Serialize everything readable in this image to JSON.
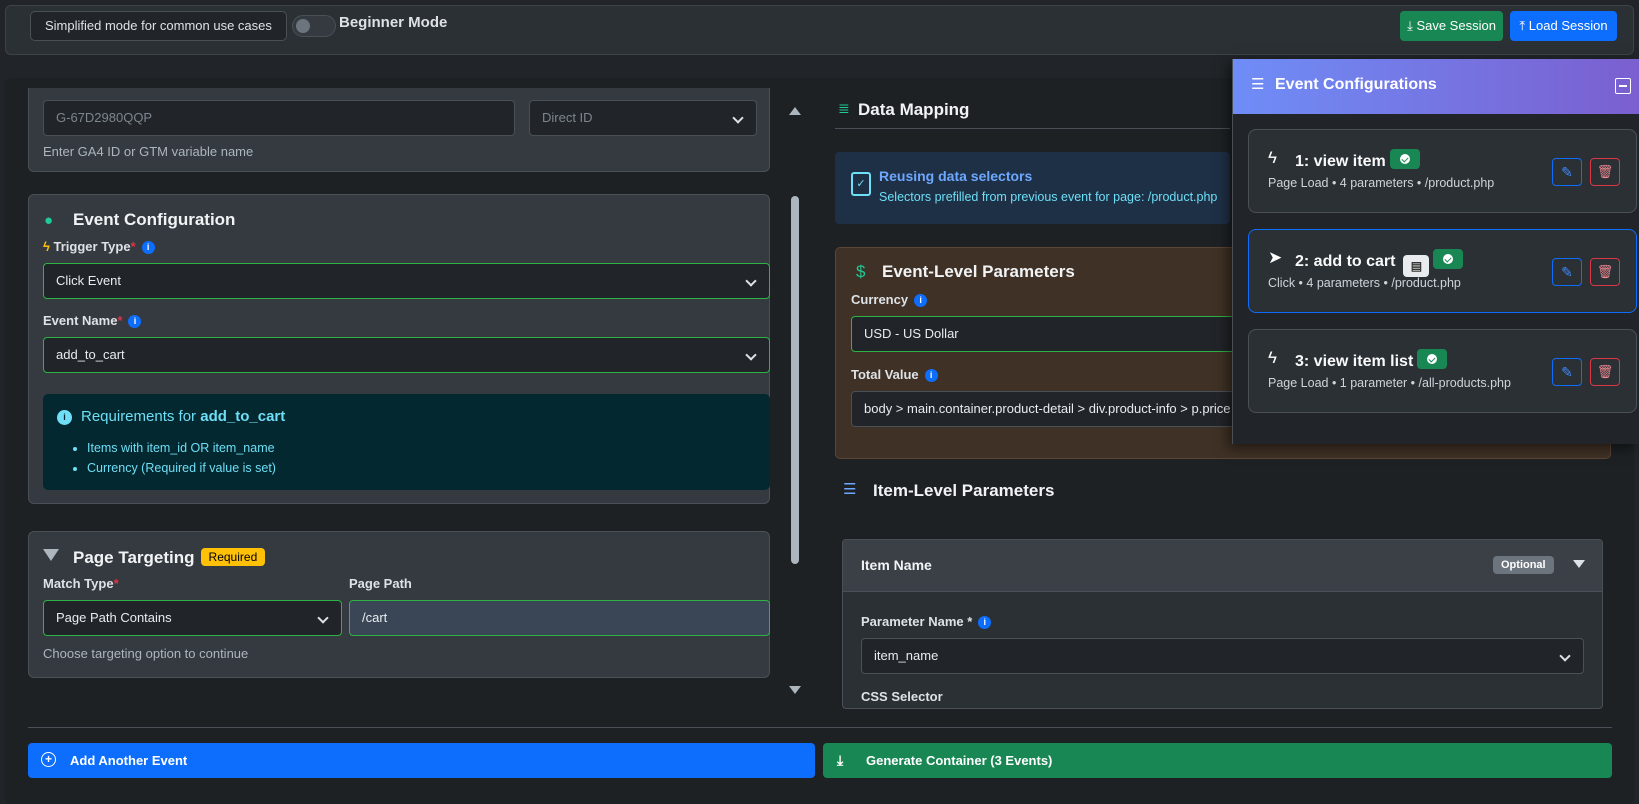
{
  "header": {
    "mode_hint": "Simplified mode for common use cases",
    "mode_label": "Beginner Mode",
    "save_label": "Save Session",
    "load_label": "Load Session"
  },
  "measurement": {
    "id_value": "G-67D2980QQP",
    "id_type": "Direct ID",
    "help": "Enter GA4 ID or GTM variable name"
  },
  "event_config": {
    "title": "Event Configuration",
    "trigger_label": "Trigger Type",
    "trigger_value": "Click Event",
    "name_label": "Event Name",
    "name_value": "add_to_cart",
    "requirements": {
      "prefix": "Requirements for",
      "event": "add_to_cart",
      "items": [
        "Items with item_id OR item_name",
        "Currency (Required if value is set)"
      ]
    }
  },
  "page_targeting": {
    "title": "Page Targeting",
    "badge": "Required",
    "match_label": "Match Type",
    "match_value": "Page Path Contains",
    "path_label": "Page Path",
    "path_value": "/cart",
    "help": "Choose targeting option to continue"
  },
  "data_mapping": {
    "title": "Data Mapping",
    "reuse_title": "Reusing data selectors",
    "reuse_text": "Selectors prefilled from previous event for page: /product.php",
    "event_params_title": "Event-Level Parameters",
    "currency_label": "Currency",
    "currency_value": "USD - US Dollar",
    "total_label": "Total Value",
    "total_value": "body > main.container.product-detail > div.product-info > p.price",
    "item_params_title": "Item-Level Parameters",
    "item": {
      "title": "Item Name",
      "badge": "Optional",
      "param_label": "Parameter Name *",
      "param_value": "item_name",
      "css_label": "CSS Selector"
    }
  },
  "panel": {
    "title": "Event Configurations",
    "events": [
      {
        "name": "1: view item",
        "meta": "Page Load • 4 parameters • /product.php"
      },
      {
        "name": "2: add to cart",
        "meta": "Click • 4 parameters • /product.php"
      },
      {
        "name": "3: view item list",
        "meta": "Page Load • 1 parameter • /all-products.php"
      }
    ]
  },
  "footer": {
    "add_label": "Add Another Event",
    "generate_label": "Generate Container (3 Events)"
  },
  "colors": {
    "primary": "#0d6efd",
    "success": "#198754",
    "warning": "#ffc107",
    "danger": "#dc3545"
  }
}
